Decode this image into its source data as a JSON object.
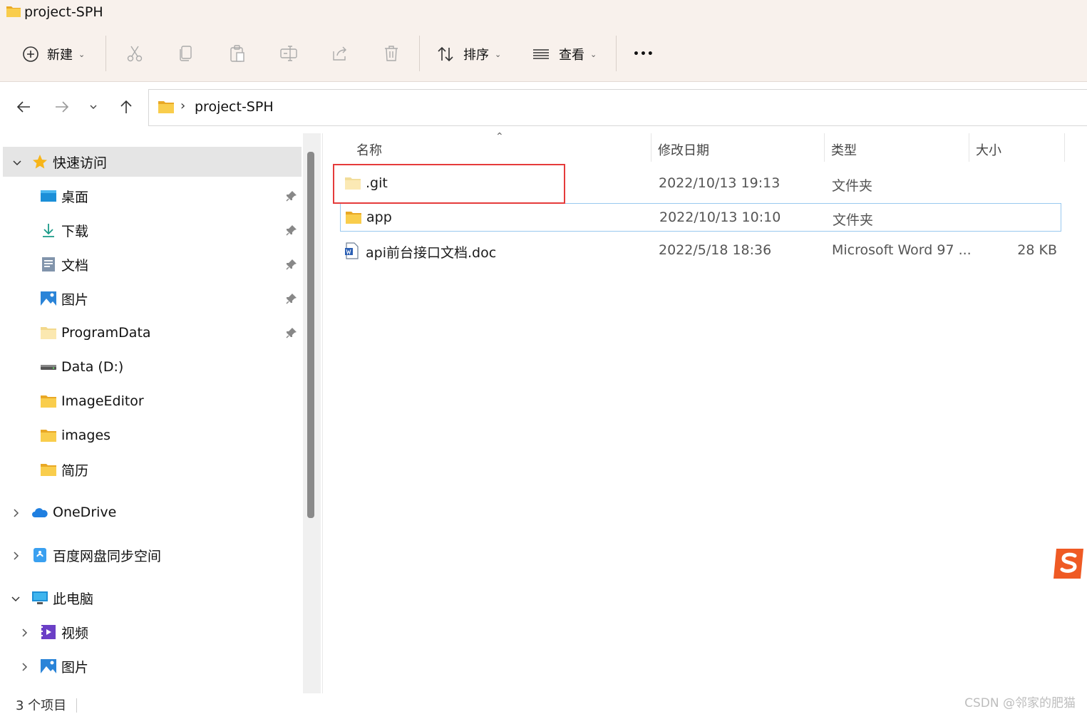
{
  "window": {
    "title": "project-SPH"
  },
  "toolbar": {
    "new_label": "新建",
    "sort_label": "排序",
    "view_label": "查看",
    "more_label": "•••",
    "icons": [
      "cut-icon",
      "copy-icon",
      "paste-icon",
      "rename-icon",
      "share-icon",
      "delete-icon"
    ]
  },
  "address": {
    "path": "project-SPH"
  },
  "sidebar": {
    "quick_access": "快速访问",
    "items": [
      {
        "label": "桌面",
        "icon": "desktop-icon",
        "pinned": true
      },
      {
        "label": "下载",
        "icon": "download-icon",
        "pinned": true
      },
      {
        "label": "文档",
        "icon": "document-icon",
        "pinned": true
      },
      {
        "label": "图片",
        "icon": "pictures-icon",
        "pinned": true
      },
      {
        "label": "ProgramData",
        "icon": "folder-icon",
        "pinned": true
      },
      {
        "label": "Data (D:)",
        "icon": "drive-icon",
        "pinned": false
      },
      {
        "label": "ImageEditor",
        "icon": "folder-icon",
        "pinned": false
      },
      {
        "label": "images",
        "icon": "folder-icon",
        "pinned": false
      },
      {
        "label": "简历",
        "icon": "folder-icon",
        "pinned": false
      }
    ],
    "onedrive": "OneDrive",
    "baidu": "百度网盘同步空间",
    "this_pc": "此电脑",
    "pc_items": [
      {
        "label": "视频",
        "icon": "video-icon"
      },
      {
        "label": "图片",
        "icon": "pictures-icon"
      }
    ]
  },
  "columns": {
    "name": "名称",
    "modified": "修改日期",
    "type": "类型",
    "size": "大小"
  },
  "files": [
    {
      "name": ".git",
      "modified": "2022/10/13 19:13",
      "type": "文件夹",
      "size": ""
    },
    {
      "name": "app",
      "modified": "2022/10/13 10:10",
      "type": "文件夹",
      "size": ""
    },
    {
      "name": "api前台接口文档.doc",
      "modified": "2022/5/18 18:36",
      "type": "Microsoft Word 97 ...",
      "size": "28 KB"
    }
  ],
  "status": {
    "count": "3 个项目"
  },
  "watermark": "CSDN @邻家的肥猫",
  "colors": {
    "highlight": "#e53b3b",
    "folder": "#f5c242",
    "toolbar_bg": "#f8f1ec"
  }
}
